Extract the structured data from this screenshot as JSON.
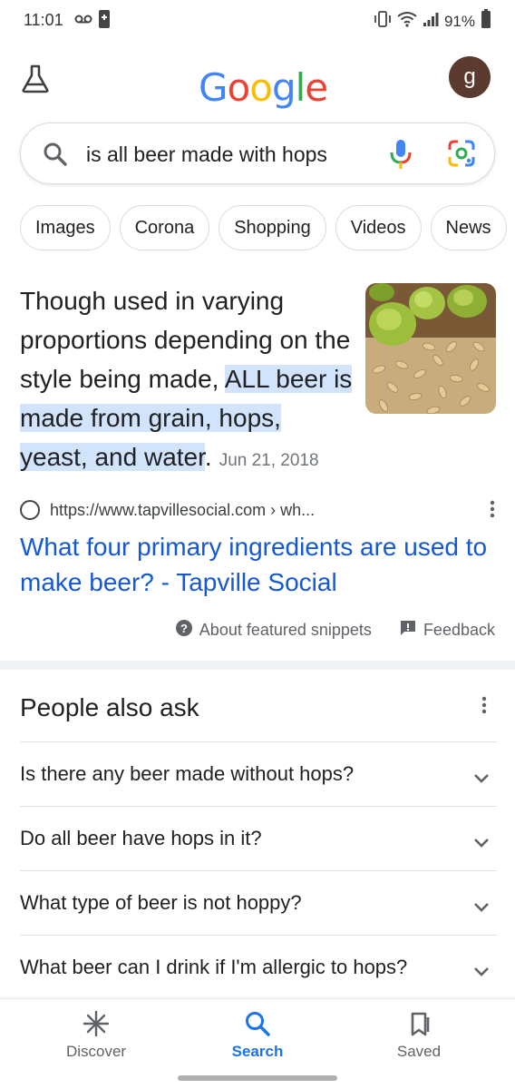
{
  "status_bar": {
    "time": "11:01",
    "battery": "91%"
  },
  "header": {
    "logo": [
      "G",
      "o",
      "o",
      "g",
      "l",
      "e"
    ],
    "logo_colors": [
      "#4285F4",
      "#EA4335",
      "#FBBC05",
      "#4285F4",
      "#34A853",
      "#EA4335"
    ],
    "avatar_letter": "g"
  },
  "search": {
    "query": "is all beer made with hops"
  },
  "chips": [
    "Images",
    "Corona",
    "Shopping",
    "Videos",
    "News"
  ],
  "snippet": {
    "text_before": "Though used in varying proportions depending on the style being made, ",
    "text_highlight": "ALL beer is made from grain, hops, yeast, and water",
    "text_after": ".",
    "date": "Jun 21, 2018",
    "source_url": "https://www.tapvillesocial.com › wh...",
    "title": "What four primary ingredients are used to make beer? - Tapville Social",
    "about_label": "About featured snippets",
    "feedback_label": "Feedback"
  },
  "people_also_ask": {
    "title": "People also ask",
    "questions": [
      "Is there any beer made without hops?",
      "Do all beer have hops in it?",
      "What type of beer is not hoppy?",
      "What beer can I drink if I'm allergic to hops?"
    ]
  },
  "bottom_nav": {
    "discover": "Discover",
    "search": "Search",
    "saved": "Saved"
  },
  "colors": {
    "link": "#1558d6",
    "highlight": "#d2e3fc",
    "active_nav": "#1a73e8"
  }
}
